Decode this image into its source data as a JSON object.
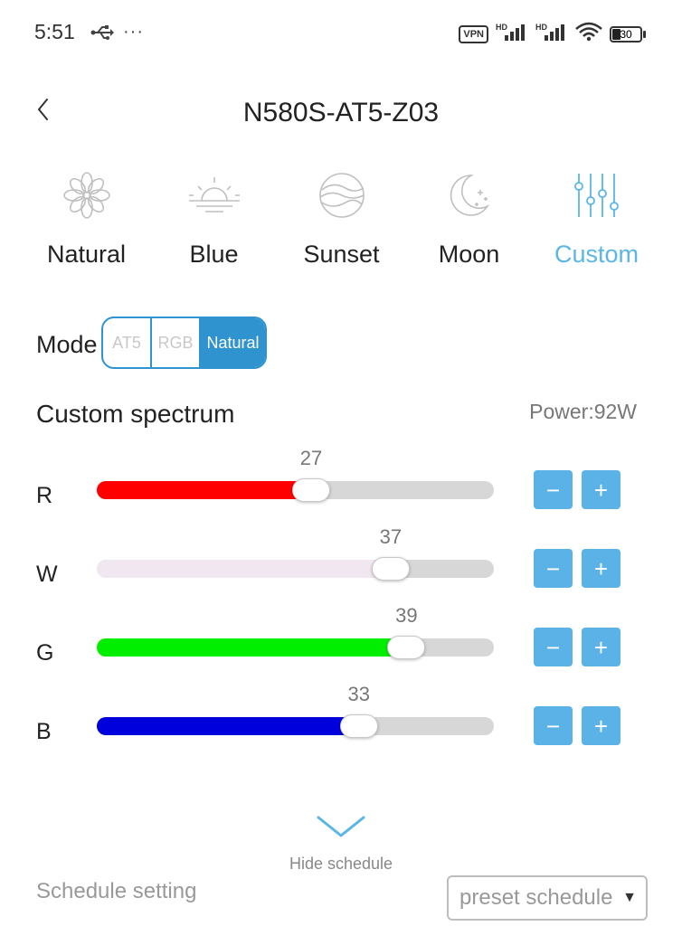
{
  "status_bar": {
    "time": "5:51",
    "dots": "···",
    "vpn": "VPN",
    "battery": "30",
    "battery_level": 0.3
  },
  "header": {
    "title": "N580S-AT5-Z03"
  },
  "mode_tabs": [
    {
      "label": "Natural",
      "icon": "flower-icon",
      "active": false
    },
    {
      "label": "Blue",
      "icon": "sunrise-icon",
      "active": false
    },
    {
      "label": "Sunset",
      "icon": "sunset-globe-icon",
      "active": false
    },
    {
      "label": "Moon",
      "icon": "moon-icon",
      "active": false
    },
    {
      "label": "Custom",
      "icon": "sliders-icon",
      "active": true
    }
  ],
  "mode": {
    "label": "Mode",
    "options": [
      "AT5",
      "RGB",
      "Natural"
    ],
    "selected": "Natural"
  },
  "spectrum": {
    "title": "Custom spectrum",
    "power": "Power:92W",
    "channels": [
      {
        "label": "R",
        "value": 27,
        "color": "#ff0000"
      },
      {
        "label": "W",
        "value": 37,
        "color": "#f1e7f1"
      },
      {
        "label": "G",
        "value": 39,
        "color": "#00ee00"
      },
      {
        "label": "B",
        "value": 33,
        "color": "#0000dd"
      }
    ],
    "minus_label": "−",
    "plus_label": "+"
  },
  "schedule": {
    "hide_label": "Hide schedule",
    "setting_label": "Schedule setting",
    "preset_value": "preset schedule"
  },
  "colors": {
    "accent": "#5bb6e6",
    "switch_blue": "#2e93cf",
    "button_blue": "#5ab2e6",
    "track_gray": "#d7d7d7"
  }
}
